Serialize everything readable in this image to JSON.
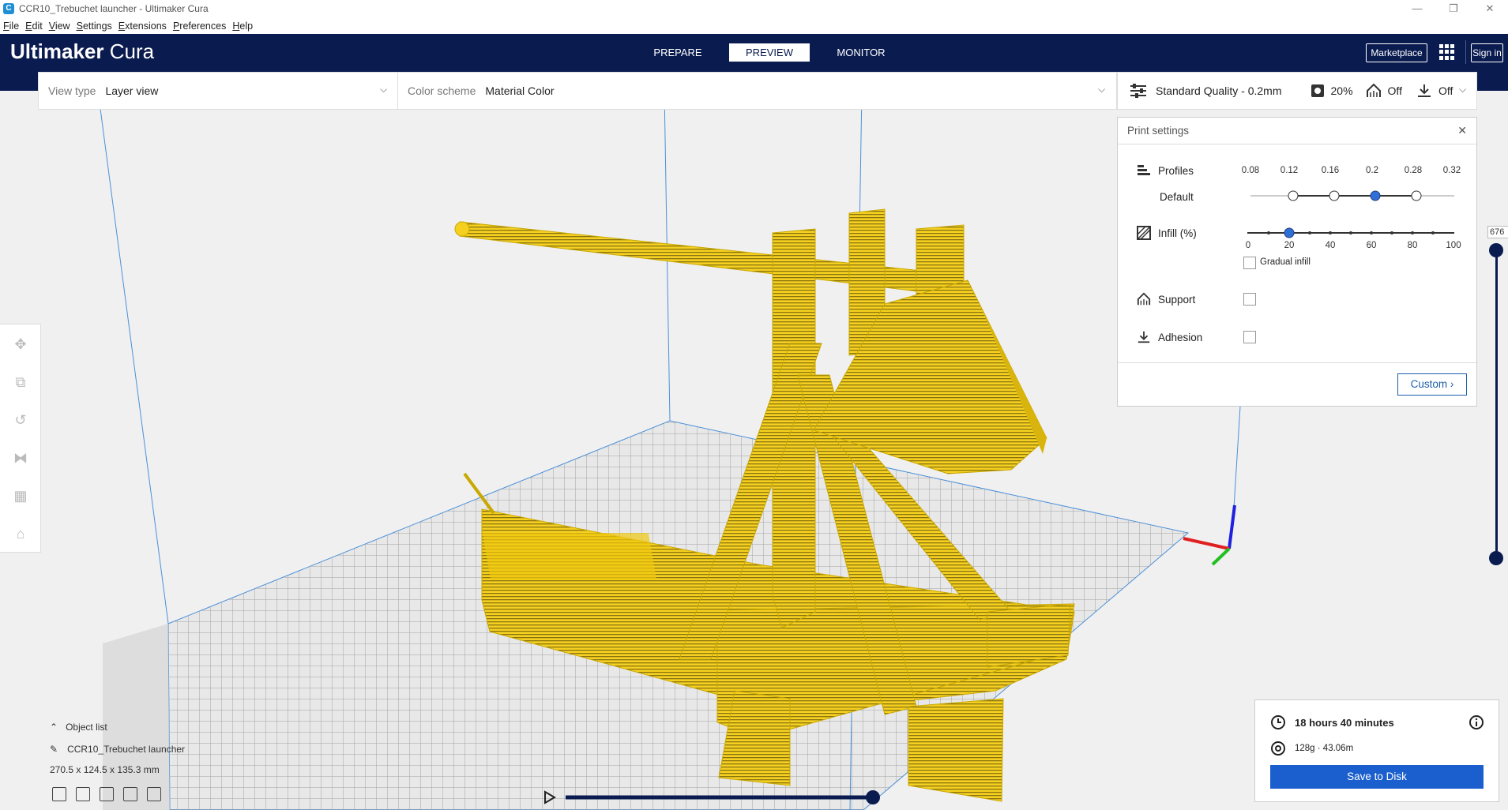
{
  "window": {
    "title": "CCR10_Trebuchet launcher - Ultimaker Cura",
    "app_icon": "C",
    "minimize": "—",
    "maximize": "❐",
    "close": "✕"
  },
  "menu": [
    "File",
    "Edit",
    "View",
    "Settings",
    "Extensions",
    "Preferences",
    "Help"
  ],
  "header": {
    "logo_bold": "Ultimaker",
    "logo_light": " Cura",
    "stages": [
      {
        "label": "PREPARE"
      },
      {
        "label": "PREVIEW",
        "active": true
      },
      {
        "label": "MONITOR"
      }
    ],
    "marketplace_label": "Marketplace",
    "signin_label": "Sign in"
  },
  "toolbar": {
    "view_type_label": "View type",
    "view_type_value": "Layer view",
    "color_scheme_label": "Color scheme",
    "color_scheme_value": "Material Color",
    "quality": "Standard Quality - 0.2mm",
    "infill": "20%",
    "support": "Off",
    "adhesion": "Off"
  },
  "print_settings": {
    "title": "Print settings",
    "profiles_label": "Profiles",
    "profile_name": "Default",
    "profile_ticks": [
      "0.08",
      "0.12",
      "0.16",
      "0.2",
      "0.28",
      "0.32"
    ],
    "profile_active_index": 3,
    "infill_label": "Infill (%)",
    "infill_ticks": [
      "0",
      "20",
      "40",
      "60",
      "80",
      "100"
    ],
    "infill_value": 20,
    "gradual_infill_label": "Gradual infill",
    "support_label": "Support",
    "adhesion_label": "Adhesion",
    "custom_label": "Custom"
  },
  "object_list": {
    "toggle_label": "Object list",
    "object_name": "CCR10_Trebuchet launcher",
    "dimensions": "270.5 x 124.5 x 135.3 mm"
  },
  "result": {
    "time": "18 hours 40 minutes",
    "material": "128g · 43.06m",
    "save_label": "Save to Disk"
  },
  "layer": {
    "current": "676"
  },
  "colors": {
    "header": "#0a1b4f",
    "accent": "#1a5fcd",
    "model": "#f5d020",
    "axis_x": "#e02020",
    "axis_y": "#20c020",
    "axis_z": "#2020e0"
  }
}
